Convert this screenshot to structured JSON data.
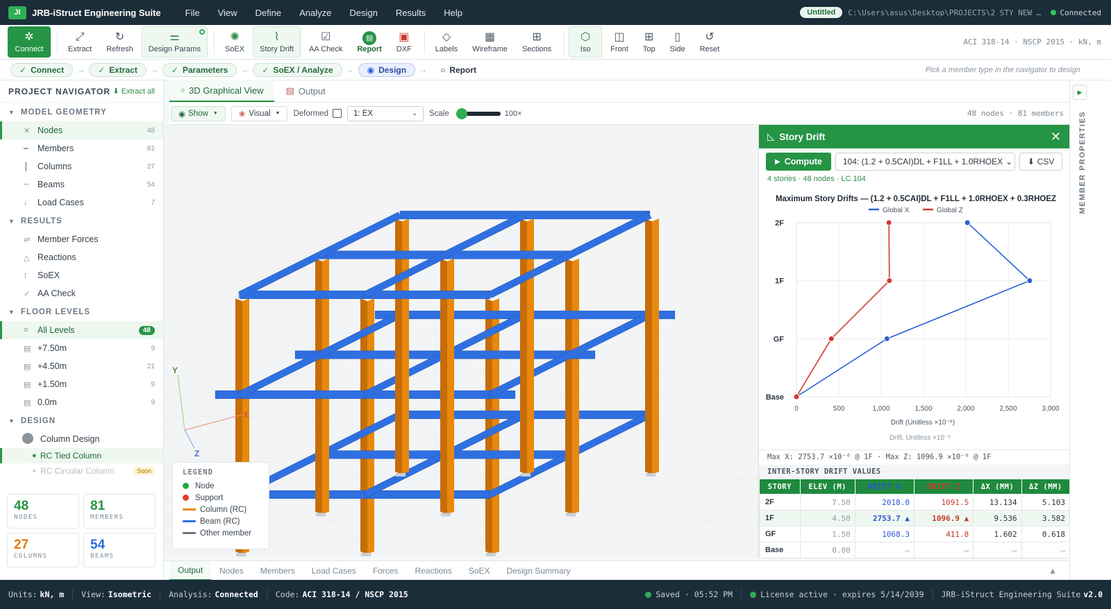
{
  "app": {
    "logo_badge": "JI",
    "title": "JRB-iStruct Engineering Suite",
    "menu": [
      "File",
      "View",
      "Define",
      "Analyze",
      "Design",
      "Results",
      "Help"
    ],
    "doc_badge": "Untitled",
    "path": "C:\\Users\\asus\\Desktop\\PROJECTS\\2 STY NEW …",
    "connection": "Connected"
  },
  "toolbar": {
    "connect": "Connect",
    "extract": "Extract",
    "refresh": "Refresh",
    "design_params": "Design Params",
    "soex": "SoEX",
    "story_drift": "Story Drift",
    "aa_check": "AA Check",
    "report": "Report",
    "dxf": "DXF",
    "labels": "Labels",
    "wireframe": "Wireframe",
    "sections": "Sections",
    "iso": "Iso",
    "front": "Front",
    "top": "Top",
    "side": "Side",
    "reset": "Reset",
    "standards": "ACI 318-14 · NSCP 2015 · kN, m"
  },
  "workflow": {
    "steps": [
      "Connect",
      "Extract",
      "Parameters",
      "SoEX / Analyze",
      "Design",
      "Report"
    ],
    "hint": "Pick a member type in the navigator to design"
  },
  "navigator": {
    "title": "PROJECT NAVIGATOR",
    "extract_all": "Extract all",
    "model_geometry": "MODEL GEOMETRY",
    "nodes": "Nodes",
    "nodes_count": "48",
    "members": "Members",
    "members_count": "81",
    "columns": "Columns",
    "columns_count": "27",
    "beams": "Beams",
    "beams_count": "54",
    "load_cases": "Load Cases",
    "load_cases_count": "7",
    "results": "RESULTS",
    "member_forces": "Member Forces",
    "reactions": "Reactions",
    "soex": "SoEX",
    "aa_check": "AA Check",
    "floor_levels": "FLOOR LEVELS",
    "all_levels": "All Levels",
    "all_levels_count": "48",
    "lvl1": "+7.50m",
    "lvl1_count": "9",
    "lvl2": "+4.50m",
    "lvl2_count": "21",
    "lvl3": "+1.50m",
    "lvl3_count": "9",
    "lvl4": "0.0m",
    "lvl4_count": "9",
    "design": "DESIGN",
    "column_design": "Column Design",
    "rc_tied": "RC Tied Column",
    "rc_circular": "RC Circular Column",
    "soon": "Soon"
  },
  "cards": {
    "nodes_v": "48",
    "nodes_l": "NODES",
    "members_v": "81",
    "members_l": "MEMBERS",
    "columns_v": "27",
    "columns_l": "COLUMNS",
    "beams_v": "54",
    "beams_l": "BEAMS"
  },
  "main_tabs": {
    "graphical": "3D Graphical View",
    "output": "Output"
  },
  "viewbar": {
    "show": "Show",
    "visual": "Visual",
    "deformed": "Deformed",
    "load_case": "1: EX",
    "scale": "Scale",
    "scale_value": "100×",
    "count": "48 nodes · 81 members"
  },
  "axes": {
    "x": "X",
    "y": "Y",
    "z": "Z"
  },
  "legend": {
    "title": "LEGEND",
    "node": "Node",
    "support": "Support",
    "column": "Column (RC)",
    "beam": "Beam (RC)",
    "other": "Other member",
    "colors": {
      "node": "#27a744",
      "support": "#e03c31",
      "column": "#e8890c",
      "beam": "#2f6fe0",
      "other": "#6b7480"
    }
  },
  "drift": {
    "title": "Story Drift",
    "compute": "Compute",
    "combo": "104: (1.2 + 0.5CAI)DL + F1LL + 1.0RHOEX",
    "csv": "CSV",
    "info": "4 stories · 48 nodes · LC 104",
    "max_line": "Max X: 2753.7 ×10⁻⁶ @ 1F  ·  Max Z: 1096.9 ×10⁻⁶ @ 1F",
    "table_title": "INTER-STORY DRIFT VALUES",
    "columns": [
      "STORY",
      "ELEV (M)",
      "DRIFT X",
      "DRIFT Z",
      "ΔX (MM)",
      "ΔZ (MM)"
    ],
    "rows": [
      {
        "story": "2F",
        "elev": "7.50",
        "dx": "2018.0",
        "dz": "1091.5",
        "ax": "13.134",
        "az": "5.103"
      },
      {
        "story": "1F",
        "elev": "4.50",
        "dx": "2753.7 ▲",
        "dz": "1096.9 ▲",
        "ax": "9.536",
        "az": "3.582"
      },
      {
        "story": "GF",
        "elev": "1.50",
        "dx": "1068.3",
        "dz": "411.8",
        "ax": "1.602",
        "az": "0.618"
      },
      {
        "story": "Base",
        "elev": "0.00",
        "dx": "—",
        "dz": "—",
        "ax": "—",
        "az": "—"
      }
    ]
  },
  "chart_data": {
    "type": "line",
    "title": "Maximum Story Drifts — (1.2 + 0.5CAI)DL + F1LL + 1.0RHOEX + 0.3RHOEZ",
    "xlabel": "Drift (Unitless ×10⁻⁶)",
    "xlabel2": "Drift, Unitless ×10⁻⁶",
    "ylabel": "",
    "xlim": [
      0,
      3000
    ],
    "x_ticks": [
      0,
      500,
      1000,
      1500,
      2000,
      2500,
      3000
    ],
    "x_tick_labels": [
      "0",
      "500",
      "1,000",
      "1,500",
      "2,000",
      "2,500",
      "3,000"
    ],
    "categories": [
      "Base",
      "GF",
      "1F",
      "2F"
    ],
    "legend_position": "top",
    "grid": true,
    "series": [
      {
        "name": "Global X",
        "color": "#2a5fd8",
        "values": [
          0,
          1068.3,
          2753.7,
          2018.0
        ]
      },
      {
        "name": "Global Z",
        "color": "#d0382e",
        "values": [
          0,
          411.8,
          1096.9,
          1091.5
        ]
      }
    ]
  },
  "member_props": {
    "label": "MEMBER PROPERTIES"
  },
  "bottom_tabs": [
    "Output",
    "Nodes",
    "Members",
    "Load Cases",
    "Forces",
    "Reactions",
    "SoEX",
    "Design Summary"
  ],
  "status": {
    "units_l": "Units:",
    "units": "kN, m",
    "view_l": "View:",
    "view": "Isometric",
    "analysis_l": "Analysis:",
    "analysis": "Connected",
    "code_l": "Code:",
    "code": "ACI 318-14 / NSCP 2015",
    "saved": "Saved · 05:52 PM",
    "license": "License active · expires 5/14/2039",
    "suite": "JRB-iStruct Engineering Suite",
    "version": "v2.0"
  }
}
